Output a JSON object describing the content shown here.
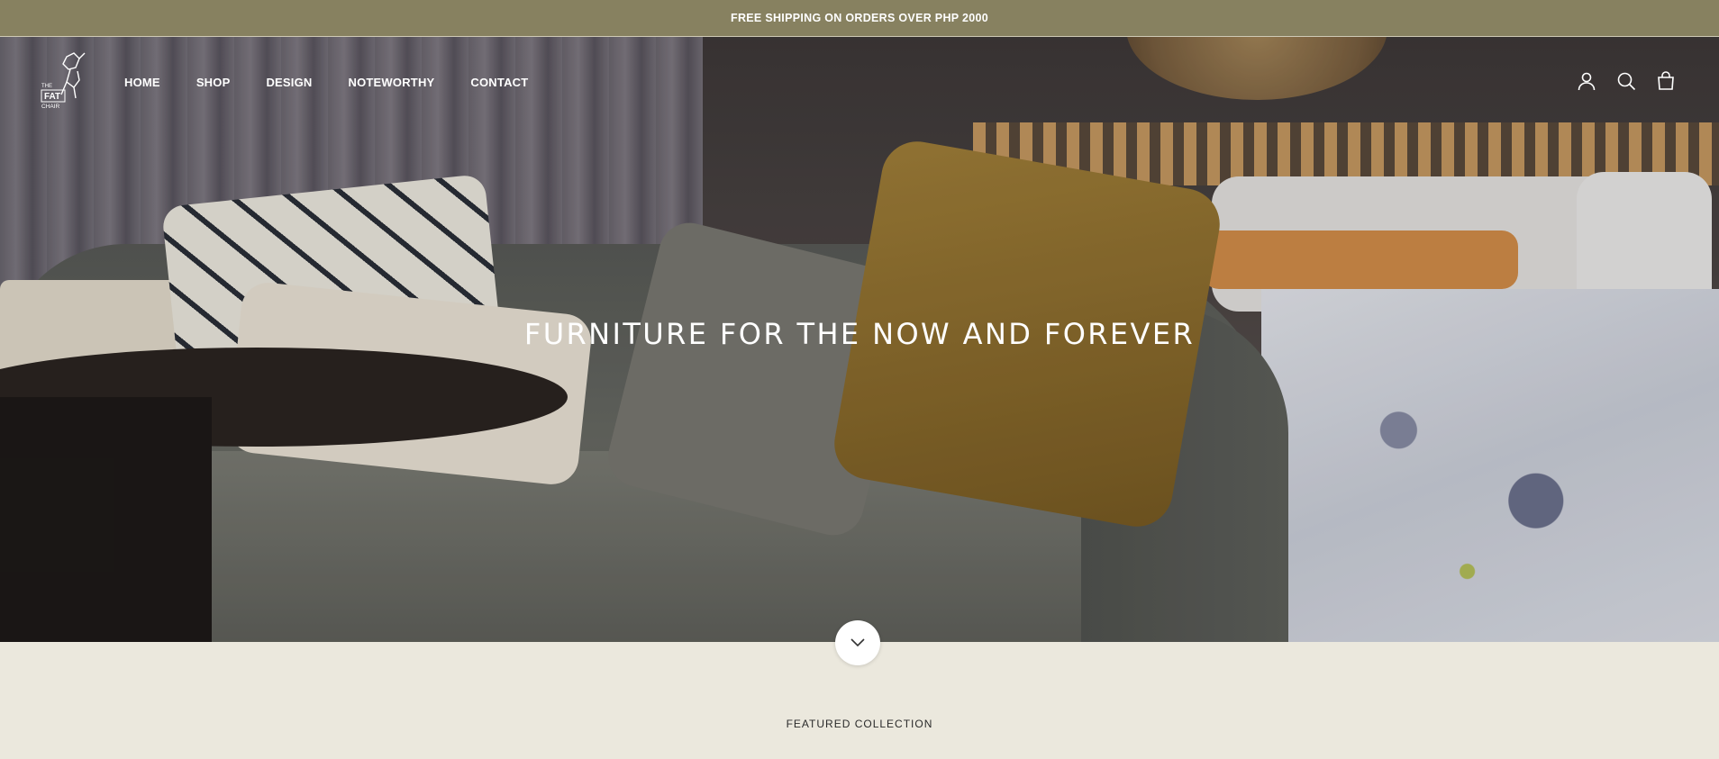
{
  "announcement": {
    "text": "FREE SHIPPING ON ORDERS OVER PHP 2000"
  },
  "brand": {
    "logo_lines": [
      "THE",
      "FAT",
      "CHAIR"
    ]
  },
  "nav": {
    "items": [
      {
        "label": "HOME"
      },
      {
        "label": "SHOP"
      },
      {
        "label": "DESIGN"
      },
      {
        "label": "NOTEWORTHY"
      },
      {
        "label": "CONTACT"
      }
    ]
  },
  "header_icons": [
    "account-icon",
    "search-icon",
    "cart-icon"
  ],
  "hero": {
    "title": "FURNITURE FOR THE NOW AND FOREVER"
  },
  "scroll_button": {
    "icon": "chevron-down-icon"
  },
  "section": {
    "heading": "FEATURED COLLECTION"
  },
  "colors": {
    "announcement_bg": "#878160",
    "page_bg": "#ebe8dd",
    "text_light": "#ffffff"
  }
}
